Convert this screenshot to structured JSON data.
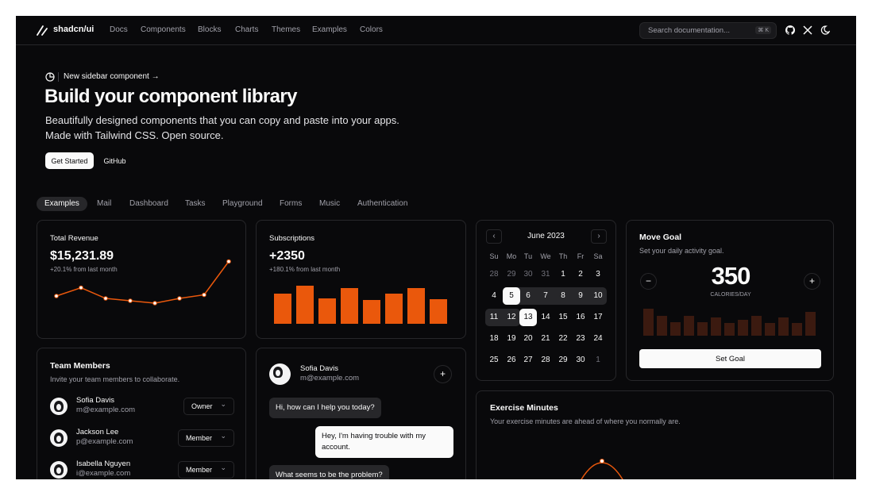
{
  "nav": {
    "brand": "shadcn/ui",
    "links": [
      "Docs",
      "Components",
      "Blocks",
      "Charts",
      "Themes",
      "Examples",
      "Colors"
    ],
    "search_placeholder": "Search documentation...",
    "search_shortcut": "⌘ K"
  },
  "hero": {
    "announcement": "New sidebar component",
    "announcement_arrow": "→",
    "title": "Build your component library",
    "subtitle_1": "Beautifully designed components that you can copy and paste into your apps.",
    "subtitle_2": "Made with Tailwind CSS. Open source.",
    "primary_button": "Get Started",
    "secondary_button": "GitHub"
  },
  "tabs": [
    "Examples",
    "Mail",
    "Dashboard",
    "Tasks",
    "Playground",
    "Forms",
    "Music",
    "Authentication"
  ],
  "revenue": {
    "label": "Total Revenue",
    "value": "$15,231.89",
    "change": "+20.1% from last month"
  },
  "subscriptions": {
    "label": "Subscriptions",
    "value": "+2350",
    "change": "+180.1% from last month"
  },
  "calendar": {
    "month": "June 2023",
    "day_names": [
      "Su",
      "Mo",
      "Tu",
      "We",
      "Th",
      "Fr",
      "Sa"
    ],
    "weeks": [
      [
        "28",
        "29",
        "30",
        "31",
        "1",
        "2",
        "3"
      ],
      [
        "4",
        "5",
        "6",
        "7",
        "8",
        "9",
        "10"
      ],
      [
        "11",
        "12",
        "13",
        "14",
        "15",
        "16",
        "17"
      ],
      [
        "18",
        "19",
        "20",
        "21",
        "22",
        "23",
        "24"
      ],
      [
        "25",
        "26",
        "27",
        "28",
        "29",
        "30",
        "1"
      ]
    ]
  },
  "move_goal": {
    "title": "Move Goal",
    "description": "Set your daily activity goal.",
    "value": "350",
    "unit": "CALORIES/DAY",
    "button": "Set Goal"
  },
  "team": {
    "title": "Team Members",
    "description": "Invite your team members to collaborate.",
    "members": [
      {
        "name": "Sofia Davis",
        "email": "m@example.com",
        "role": "Owner"
      },
      {
        "name": "Jackson Lee",
        "email": "p@example.com",
        "role": "Member"
      },
      {
        "name": "Isabella Nguyen",
        "email": "i@example.com",
        "role": "Member"
      }
    ]
  },
  "chat": {
    "name": "Sofia Davis",
    "email": "m@example.com",
    "messages": [
      {
        "from": "agent",
        "text": "Hi, how can I help you today?"
      },
      {
        "from": "user",
        "text": "Hey, I'm having trouble with my account."
      },
      {
        "from": "agent",
        "text": "What seems to be the problem?"
      }
    ]
  },
  "exercise": {
    "title": "Exercise Minutes",
    "description": "Your exercise minutes are ahead of where you normally are."
  },
  "colors": {
    "accent": "#ea580c",
    "goal_bar": "#3b1a10"
  },
  "chart_data": [
    {
      "type": "line",
      "title": "Total Revenue",
      "values": [
        20,
        27,
        18,
        16,
        14,
        18,
        21,
        49
      ]
    },
    {
      "type": "bar",
      "title": "Subscriptions",
      "values": [
        38,
        48,
        32,
        45,
        30,
        38,
        45,
        31
      ]
    },
    {
      "type": "bar",
      "title": "Move Goal",
      "values": [
        34,
        25,
        17,
        25,
        17,
        23,
        16,
        20,
        25,
        16,
        23,
        16,
        30
      ]
    }
  ]
}
